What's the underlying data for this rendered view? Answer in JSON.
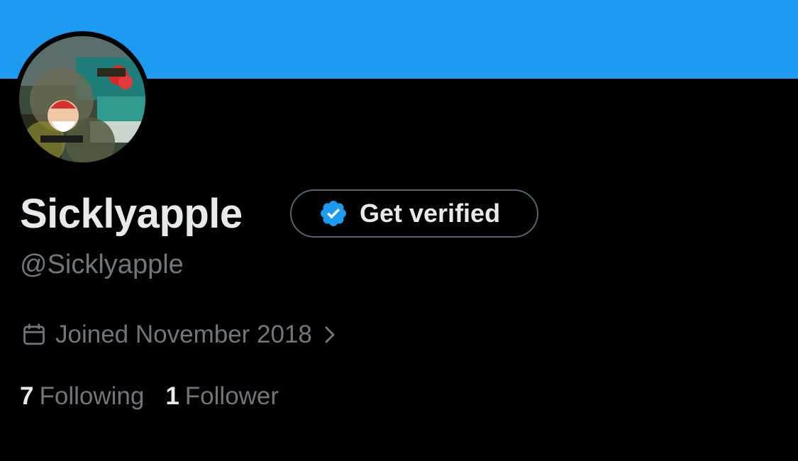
{
  "profile": {
    "display_name": "Sicklyapple",
    "handle": "@Sicklyapple",
    "joined": "Joined November 2018",
    "verify_label": "Get verified"
  },
  "stats": {
    "following_count": "7",
    "following_label": "Following",
    "followers_count": "1",
    "followers_label": "Follower"
  },
  "icons": {
    "verify": "verified-badge-icon",
    "calendar": "calendar-icon",
    "chevron": "chevron-right-icon"
  },
  "colors": {
    "banner": "#1D9BF0",
    "background": "#000000",
    "primary_text": "#E7E9EA",
    "secondary_text": "#71767B",
    "verified_blue": "#1D9BF0"
  }
}
